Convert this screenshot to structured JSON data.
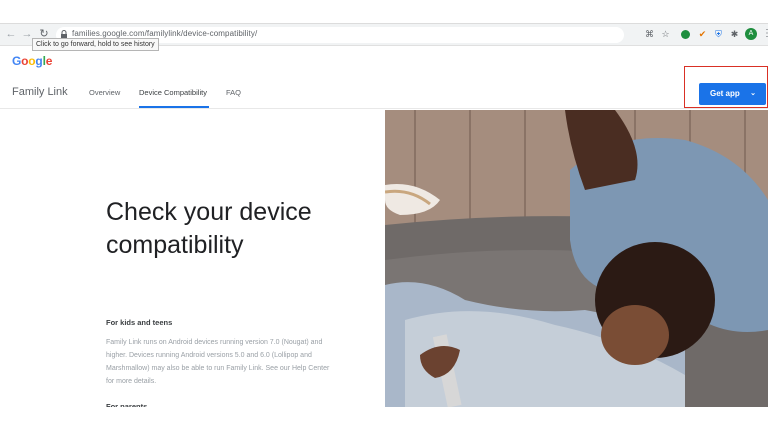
{
  "browser": {
    "url": "families.google.com/familylink/device-compatibility/",
    "tooltip": "Click to go forward, hold to see history",
    "avatar_letter": "A",
    "icons": [
      "back-icon",
      "forward-icon",
      "reload-icon",
      "lock-icon",
      "star-icon",
      "extension-icon",
      "kebab-icon"
    ]
  },
  "logo": {
    "letters": [
      {
        "ch": "G",
        "color": "#4285f4"
      },
      {
        "ch": "o",
        "color": "#ea4335"
      },
      {
        "ch": "o",
        "color": "#fbbc05"
      },
      {
        "ch": "g",
        "color": "#4285f4"
      },
      {
        "ch": "l",
        "color": "#34a853"
      },
      {
        "ch": "e",
        "color": "#ea4335"
      }
    ]
  },
  "nav": {
    "brand": "Family Link",
    "overview": "Overview",
    "device_compat": "Device Compatibility",
    "faq": "FAQ",
    "get_app": "Get app"
  },
  "hero": {
    "title": "Check your device compatibility",
    "kids_heading": "For kids and teens",
    "kids_text": "Family Link runs on Android devices running version 7.0 (Nougat) and higher. Devices running Android versions 5.0 and 6.0 (Lollipop and Marshmallow) may also be able to run Family Link. See our Help Center for more details.",
    "parents_heading": "For parents"
  },
  "colors": {
    "accent": "#1a73e8",
    "highlight_box": "#d93025"
  }
}
